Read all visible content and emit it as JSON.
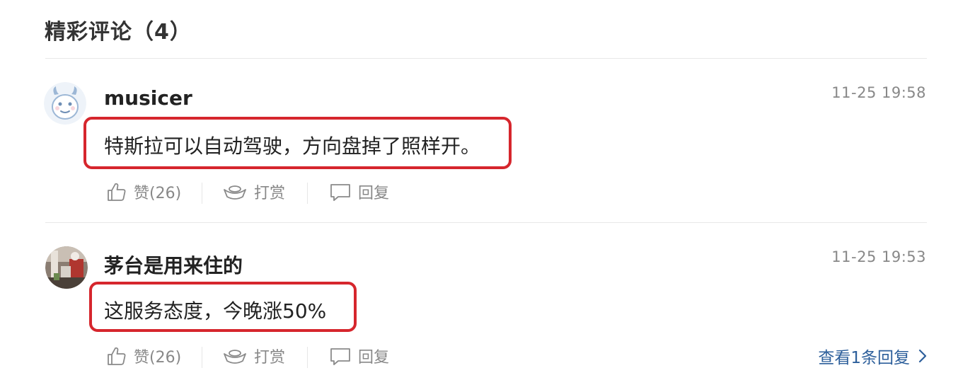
{
  "section": {
    "title": "精彩评论（4）"
  },
  "comments": [
    {
      "username": "musicer",
      "timestamp": "11-25 19:58",
      "text": "特斯拉可以自动驾驶，方向盘掉了照样开。",
      "like_label": "赞(26)",
      "reward_label": "打赏",
      "reply_label": "回复",
      "avatar_icon": "cartoon-cow-avatar"
    },
    {
      "username": "茅台是用来住的",
      "timestamp": "11-25 19:53",
      "text": "这服务态度，今晚涨50%",
      "like_label": "赞(26)",
      "reward_label": "打赏",
      "reply_label": "回复",
      "avatar_icon": "photo-avatar",
      "view_replies_label": "查看1条回复"
    }
  ],
  "colors": {
    "highlight_border": "#d6262d",
    "link": "#2d5f9b",
    "meta_text": "#888888"
  }
}
